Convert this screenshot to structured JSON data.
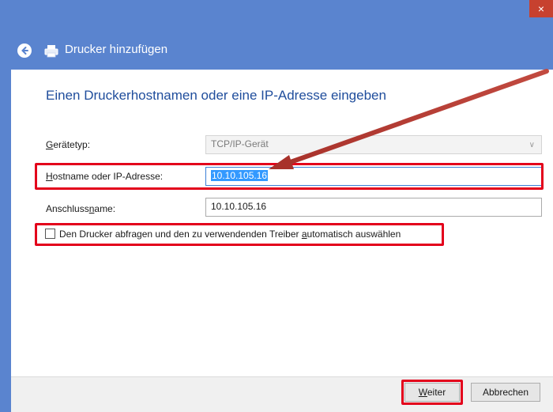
{
  "window": {
    "close_label": "×",
    "title": "Drucker hinzufügen"
  },
  "heading": "Einen Druckerhostnamen oder eine IP-Adresse eingeben",
  "fields": {
    "device_type": {
      "label_pre": "",
      "label_key": "G",
      "label_post": "erätetyp:",
      "value": "TCP/IP-Gerät"
    },
    "hostname": {
      "label_pre": "",
      "label_key": "H",
      "label_post": "ostname oder IP-Adresse:",
      "value": "10.10.105.16"
    },
    "port_name": {
      "label_pre": "Anschluss",
      "label_key": "n",
      "label_post": "ame:",
      "value": "10.10.105.16"
    }
  },
  "checkbox": {
    "label_pre": "Den Drucker abfragen und den zu verwendenden Treiber ",
    "label_key": "a",
    "label_post": "utomatisch auswählen",
    "checked": false
  },
  "buttons": {
    "next_key": "W",
    "next_rest": "eiter",
    "cancel": "Abbrechen"
  },
  "colors": {
    "titlebar": "#5a84cf",
    "heading": "#1f4d9c",
    "highlight": "#e3001b",
    "arrow": "#b83a32"
  }
}
